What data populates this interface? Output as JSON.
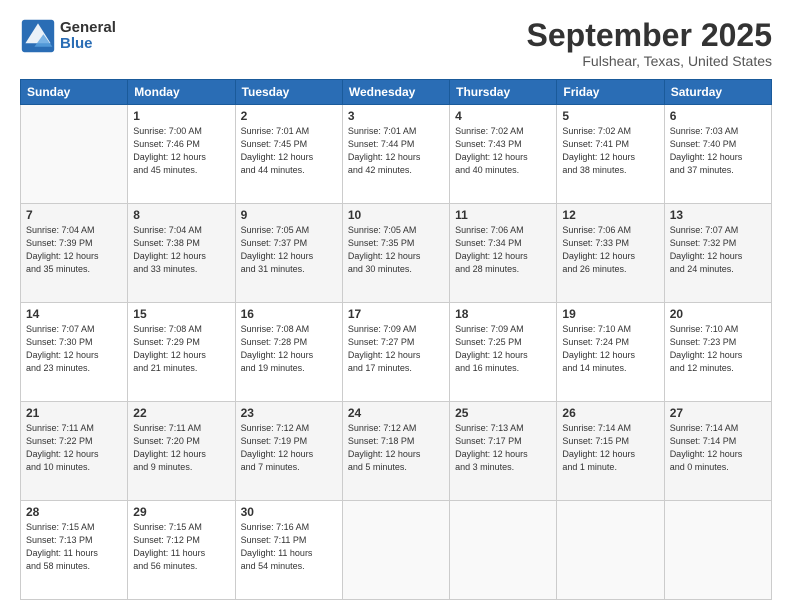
{
  "logo": {
    "general": "General",
    "blue": "Blue"
  },
  "title": {
    "month": "September 2025",
    "location": "Fulshear, Texas, United States"
  },
  "weekdays": [
    "Sunday",
    "Monday",
    "Tuesday",
    "Wednesday",
    "Thursday",
    "Friday",
    "Saturday"
  ],
  "weeks": [
    [
      {
        "day": "",
        "info": ""
      },
      {
        "day": "1",
        "info": "Sunrise: 7:00 AM\nSunset: 7:46 PM\nDaylight: 12 hours\nand 45 minutes."
      },
      {
        "day": "2",
        "info": "Sunrise: 7:01 AM\nSunset: 7:45 PM\nDaylight: 12 hours\nand 44 minutes."
      },
      {
        "day": "3",
        "info": "Sunrise: 7:01 AM\nSunset: 7:44 PM\nDaylight: 12 hours\nand 42 minutes."
      },
      {
        "day": "4",
        "info": "Sunrise: 7:02 AM\nSunset: 7:43 PM\nDaylight: 12 hours\nand 40 minutes."
      },
      {
        "day": "5",
        "info": "Sunrise: 7:02 AM\nSunset: 7:41 PM\nDaylight: 12 hours\nand 38 minutes."
      },
      {
        "day": "6",
        "info": "Sunrise: 7:03 AM\nSunset: 7:40 PM\nDaylight: 12 hours\nand 37 minutes."
      }
    ],
    [
      {
        "day": "7",
        "info": "Sunrise: 7:04 AM\nSunset: 7:39 PM\nDaylight: 12 hours\nand 35 minutes."
      },
      {
        "day": "8",
        "info": "Sunrise: 7:04 AM\nSunset: 7:38 PM\nDaylight: 12 hours\nand 33 minutes."
      },
      {
        "day": "9",
        "info": "Sunrise: 7:05 AM\nSunset: 7:37 PM\nDaylight: 12 hours\nand 31 minutes."
      },
      {
        "day": "10",
        "info": "Sunrise: 7:05 AM\nSunset: 7:35 PM\nDaylight: 12 hours\nand 30 minutes."
      },
      {
        "day": "11",
        "info": "Sunrise: 7:06 AM\nSunset: 7:34 PM\nDaylight: 12 hours\nand 28 minutes."
      },
      {
        "day": "12",
        "info": "Sunrise: 7:06 AM\nSunset: 7:33 PM\nDaylight: 12 hours\nand 26 minutes."
      },
      {
        "day": "13",
        "info": "Sunrise: 7:07 AM\nSunset: 7:32 PM\nDaylight: 12 hours\nand 24 minutes."
      }
    ],
    [
      {
        "day": "14",
        "info": "Sunrise: 7:07 AM\nSunset: 7:30 PM\nDaylight: 12 hours\nand 23 minutes."
      },
      {
        "day": "15",
        "info": "Sunrise: 7:08 AM\nSunset: 7:29 PM\nDaylight: 12 hours\nand 21 minutes."
      },
      {
        "day": "16",
        "info": "Sunrise: 7:08 AM\nSunset: 7:28 PM\nDaylight: 12 hours\nand 19 minutes."
      },
      {
        "day": "17",
        "info": "Sunrise: 7:09 AM\nSunset: 7:27 PM\nDaylight: 12 hours\nand 17 minutes."
      },
      {
        "day": "18",
        "info": "Sunrise: 7:09 AM\nSunset: 7:25 PM\nDaylight: 12 hours\nand 16 minutes."
      },
      {
        "day": "19",
        "info": "Sunrise: 7:10 AM\nSunset: 7:24 PM\nDaylight: 12 hours\nand 14 minutes."
      },
      {
        "day": "20",
        "info": "Sunrise: 7:10 AM\nSunset: 7:23 PM\nDaylight: 12 hours\nand 12 minutes."
      }
    ],
    [
      {
        "day": "21",
        "info": "Sunrise: 7:11 AM\nSunset: 7:22 PM\nDaylight: 12 hours\nand 10 minutes."
      },
      {
        "day": "22",
        "info": "Sunrise: 7:11 AM\nSunset: 7:20 PM\nDaylight: 12 hours\nand 9 minutes."
      },
      {
        "day": "23",
        "info": "Sunrise: 7:12 AM\nSunset: 7:19 PM\nDaylight: 12 hours\nand 7 minutes."
      },
      {
        "day": "24",
        "info": "Sunrise: 7:12 AM\nSunset: 7:18 PM\nDaylight: 12 hours\nand 5 minutes."
      },
      {
        "day": "25",
        "info": "Sunrise: 7:13 AM\nSunset: 7:17 PM\nDaylight: 12 hours\nand 3 minutes."
      },
      {
        "day": "26",
        "info": "Sunrise: 7:14 AM\nSunset: 7:15 PM\nDaylight: 12 hours\nand 1 minute."
      },
      {
        "day": "27",
        "info": "Sunrise: 7:14 AM\nSunset: 7:14 PM\nDaylight: 12 hours\nand 0 minutes."
      }
    ],
    [
      {
        "day": "28",
        "info": "Sunrise: 7:15 AM\nSunset: 7:13 PM\nDaylight: 11 hours\nand 58 minutes."
      },
      {
        "day": "29",
        "info": "Sunrise: 7:15 AM\nSunset: 7:12 PM\nDaylight: 11 hours\nand 56 minutes."
      },
      {
        "day": "30",
        "info": "Sunrise: 7:16 AM\nSunset: 7:11 PM\nDaylight: 11 hours\nand 54 minutes."
      },
      {
        "day": "",
        "info": ""
      },
      {
        "day": "",
        "info": ""
      },
      {
        "day": "",
        "info": ""
      },
      {
        "day": "",
        "info": ""
      }
    ]
  ]
}
